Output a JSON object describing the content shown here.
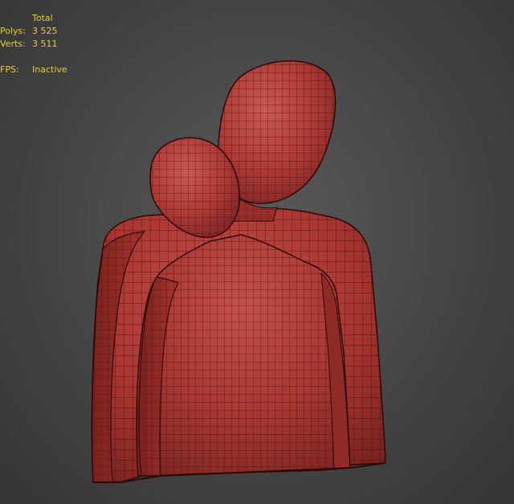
{
  "viewport": {
    "stats": {
      "header": "Total",
      "polys_label": "Polys:",
      "polys_value": "3 525",
      "verts_label": "Verts:",
      "verts_value": "3 511",
      "fps_label": "FPS:",
      "fps_value": "Inactive"
    },
    "colors": {
      "stats_text": "#e8c84a",
      "mesh_fill": "#b8413e",
      "wire": "#4a0e0c",
      "background": "#474747"
    },
    "model": {
      "icon": "sculpture-mesh-icon"
    }
  }
}
